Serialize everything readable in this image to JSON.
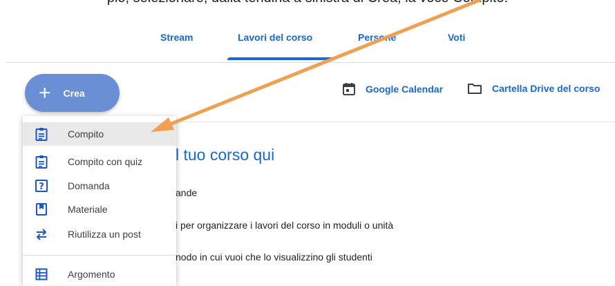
{
  "caption": {
    "text": "pio, selezionare, dalla tendina a sinistra di Crea, la voce Compito:"
  },
  "tabs": [
    {
      "label": "Stream"
    },
    {
      "label": "Lavori del corso"
    },
    {
      "label": "Persone"
    },
    {
      "label": "Voti"
    }
  ],
  "crea": {
    "plus": "+",
    "label": "Crea"
  },
  "toolbar": {
    "calendar_label": "Google Calendar",
    "drive_label": "Cartella Drive del corso"
  },
  "content": {
    "heading": "l tuo corso qui",
    "line1": "ande",
    "line2": "i per organizzare i lavori del corso in moduli o unità",
    "line3": "nodo in cui vuoi che lo visualizzino gli studenti"
  },
  "menu": {
    "items": [
      {
        "label": "Compito",
        "icon": "assignment-icon"
      },
      {
        "label": "Compito con quiz",
        "icon": "quiz-assignment-icon"
      },
      {
        "label": "Domanda",
        "icon": "question-icon"
      },
      {
        "label": "Materiale",
        "icon": "material-icon"
      },
      {
        "label": "Riutilizza un post",
        "icon": "reuse-post-icon"
      },
      {
        "label": "Argomento",
        "icon": "topic-icon"
      }
    ]
  },
  "colors": {
    "accent": "#1967d2",
    "crea_button": "#6b8fd4",
    "arrow": "#f0a050",
    "highlight": "#e9e9e9"
  }
}
